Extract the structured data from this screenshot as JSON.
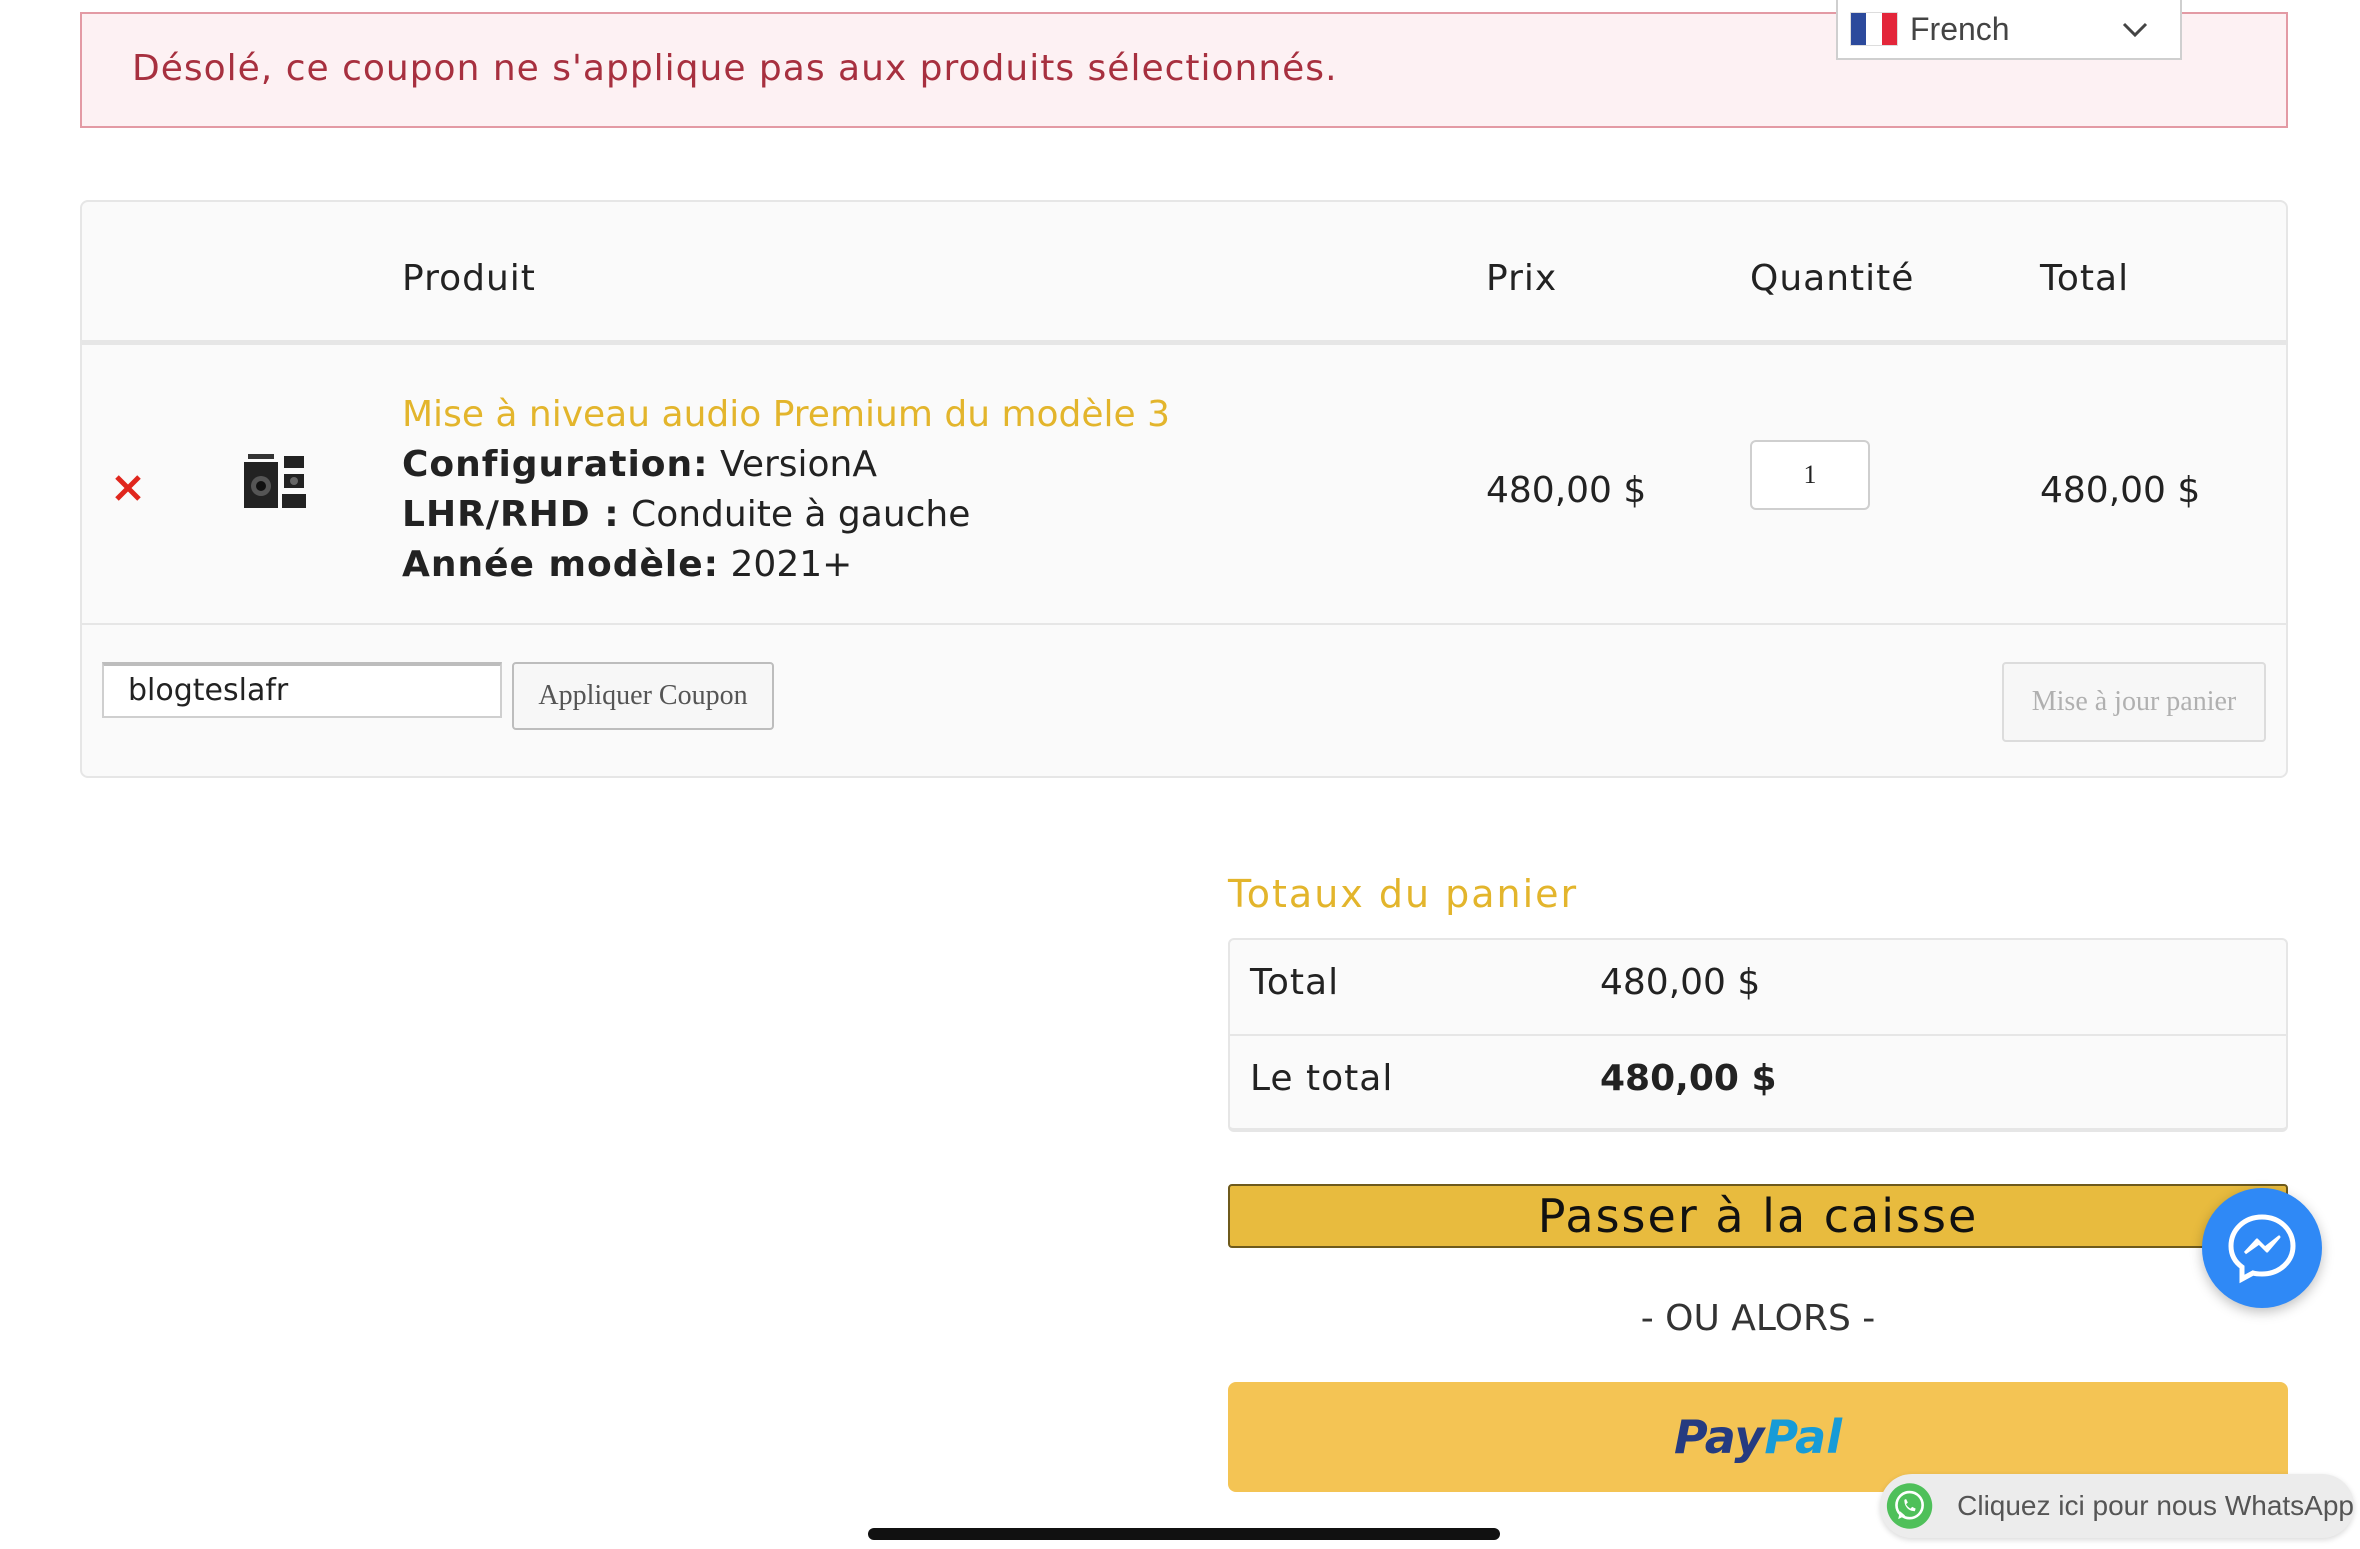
{
  "notice": {
    "error_message": "Désolé, ce coupon ne s'applique pas aux produits sélectionnés."
  },
  "language_selector": {
    "label": "French",
    "flag_icon": "france-flag-icon",
    "chevron_icon": "chevron-down-icon"
  },
  "cart": {
    "headers": {
      "product": "Produit",
      "price": "Prix",
      "quantity": "Quantité",
      "total": "Total"
    },
    "items": [
      {
        "remove_icon": "remove-x-icon",
        "remove_symbol": "✕",
        "name": "Mise à niveau audio Premium du modèle 3",
        "meta": [
          {
            "label": "Configuration:",
            "value": " VersionA"
          },
          {
            "label": "LHR/RHD :",
            "value": " Conduite à gauche"
          },
          {
            "label": "Année modèle:",
            "value": " 2021+"
          }
        ],
        "price": "480,00 $",
        "quantity": "1",
        "line_total": "480,00 $"
      }
    ],
    "coupon_code": "blogteslafr",
    "apply_coupon_label": "Appliquer Coupon",
    "update_cart_label": "Mise à jour panier"
  },
  "totals": {
    "heading": "Totaux du panier",
    "rows": [
      {
        "label": "Total",
        "value": "480,00 $"
      },
      {
        "label": "Le total",
        "value": "480,00 $"
      }
    ],
    "checkout_label": "Passer à la caisse",
    "or_label": "- OU ALORS -",
    "paypal_pay": "Pay",
    "paypal_pal": "Pal"
  },
  "widgets": {
    "messenger_icon": "messenger-icon",
    "whatsapp_icon": "whatsapp-icon",
    "whatsapp_label": "Cliquez ici pour nous WhatsApp"
  },
  "colors": {
    "accent_gold": "#e3b52c",
    "error_text": "#a7303f",
    "checkout_bg": "#e8bb3e",
    "paypal_bg": "#f4c454",
    "messenger_blue": "#2f89f6",
    "remove_red": "#e0261d"
  }
}
